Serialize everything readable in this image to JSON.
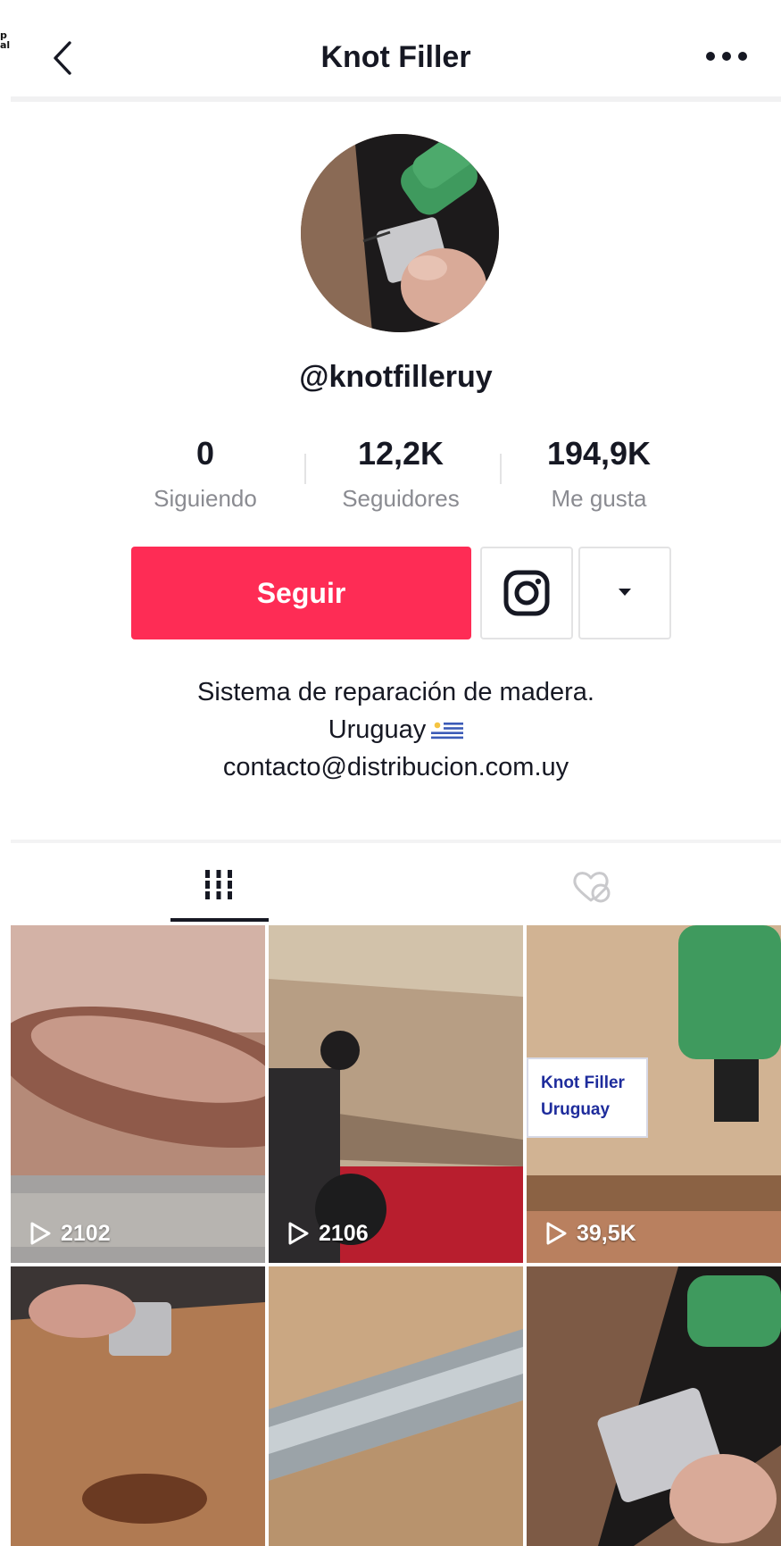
{
  "header": {
    "title": "Knot Filler"
  },
  "profile": {
    "username": "@knotfilleruy"
  },
  "stats": [
    {
      "value": "0",
      "label": "Siguiendo"
    },
    {
      "value": "12,2K",
      "label": "Seguidores"
    },
    {
      "value": "194,9K",
      "label": "Me gusta"
    }
  ],
  "actions": {
    "follow_label": "Seguir"
  },
  "bio": {
    "line1": "Sistema de reparación de madera.",
    "line2": "Uruguay",
    "line3": "contacto@distribucion.com.uy"
  },
  "colors": {
    "accent": "#fe2c55",
    "text": "#161823",
    "muted": "#8a8b91"
  },
  "grid": {
    "videos": [
      {
        "views": "2102"
      },
      {
        "views": "2106"
      },
      {
        "views": "39,5K",
        "overlay_line1": "Knot Filler",
        "overlay_line2": "Uruguay"
      },
      {
        "views": ""
      },
      {
        "views": ""
      },
      {
        "views": ""
      }
    ]
  }
}
